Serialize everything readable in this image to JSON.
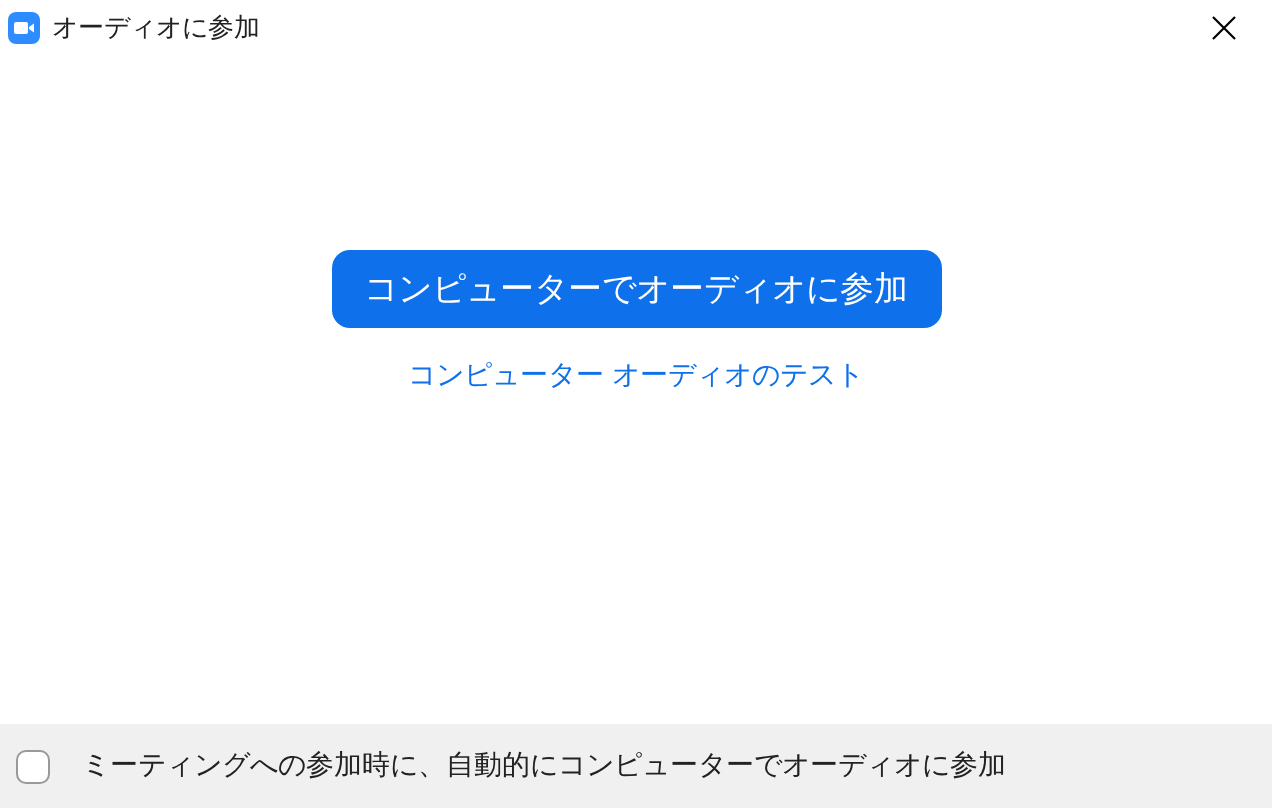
{
  "window": {
    "title": "オーディオに参加"
  },
  "join_button": {
    "label": "コンピューターでオーディオに参加"
  },
  "test_link": {
    "label": "コンピューター オーディオのテスト"
  },
  "auto_join": {
    "label": "ミーティングへの参加時に、自動的にコンピューターでオーディオに参加",
    "checked": false
  }
}
